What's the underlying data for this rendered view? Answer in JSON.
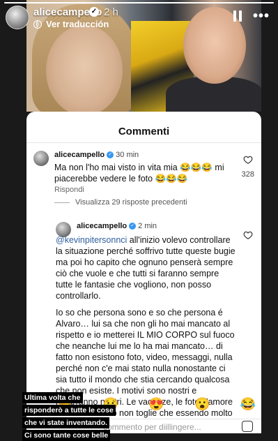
{
  "story": {
    "username": "alicecampello",
    "time": "2 h",
    "translate_label": "Ver traducción",
    "progress_percent": 100
  },
  "sheet": {
    "title": "Commenti"
  },
  "comments": [
    {
      "username": "alicecampello",
      "time": "30 min",
      "text": "Ma non l'ho mai visto in vita mia 😂😂😂 mi piacerebbe vedere le foto 😂😂😂",
      "likes": "328",
      "reply_label": "Rispondi"
    }
  ],
  "view_replies_label": "Visualizza 29 risposte precedenti",
  "reply": {
    "username": "alicecampello",
    "time": "2 min",
    "mention": "@kevinpitersonnci",
    "paragraph1": " all'inizio volevo controllare la situazione perché soffrivo tutte queste bugie ma poi ho capito che ognuno penserà sempre ciò che vuole e che tutti si faranno sempre tutte le fantasie che vogliono, non posso controllarlo.",
    "paragraph2": "Io so che persona sono e so che persona é Alvaro… lui sa che non gli ho mai mancato al rispetto e io metterei IL MIO CORPO sul fuoco che neanche lui me lo ha mai mancato… di fatto non esistono foto, video, messaggi, nulla perché non c'e mai stato nulla nonostante ci sia tutto il mondo che stia cercando qualcosa che non esiste. I motivi sono nostri e rimarranno nostri. Le vacanze, le foto, l'amore é vero… ma ciò non toglie che essendo molto giovani e avendo"
  },
  "reactions": [
    "👏",
    "😢",
    "😍",
    "😮",
    "😂"
  ],
  "comment_bar": {
    "placeholder": "commento per diillingere..."
  },
  "caption_lines": [
    "Ultima volta che",
    "risponderò a tutte le cose",
    "che vi state inventando.",
    "Ci sono tante cose belle"
  ]
}
